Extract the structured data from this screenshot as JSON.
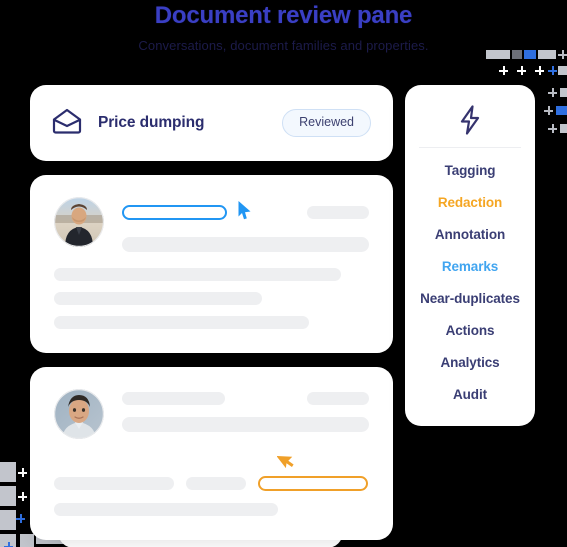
{
  "header": {
    "title": "Document review pane",
    "subtitle": "Conversations, document families and properties."
  },
  "colors": {
    "background": "#000000",
    "title": "#3a3fc4",
    "subtitle": "#1c1b4a",
    "card": "#ffffff",
    "navy": "#2b2d6e",
    "badge_border": "#cfe0f5",
    "badge_bg": "#f3f8fe",
    "accent_blue": "#2196f3",
    "accent_orange": "#f0a029",
    "skeleton": "#eeeff1",
    "menu_orange": "#f5a623",
    "menu_lightblue": "#41a5f0",
    "deco_gray": "#b9bcc4",
    "deco_blue": "#2f6fe0"
  },
  "subject_card": {
    "icon": "open-envelope-icon",
    "title": "Price dumping",
    "badge": "Reviewed"
  },
  "message_cards": [
    {
      "avatar": "avatar-person-1",
      "highlight": "blue",
      "cursor": "blue-arrow-cursor"
    },
    {
      "avatar": "avatar-person-2",
      "highlight": "orange",
      "cursor": "orange-arrow-cursor"
    }
  ],
  "sidebar": {
    "icon": "lightning-bolt-icon",
    "items": [
      {
        "label": "Tagging",
        "style": "default"
      },
      {
        "label": "Redaction",
        "style": "orange"
      },
      {
        "label": "Annotation",
        "style": "default"
      },
      {
        "label": "Remarks",
        "style": "lightblue"
      },
      {
        "label": "Near-duplicates",
        "style": "default"
      },
      {
        "label": "Actions",
        "style": "default"
      },
      {
        "label": "Analytics",
        "style": "default"
      },
      {
        "label": "Audit",
        "style": "default"
      }
    ]
  },
  "decorations": {
    "top_right": "cross-dot-pattern",
    "bottom_left": "cross-dot-pattern"
  }
}
